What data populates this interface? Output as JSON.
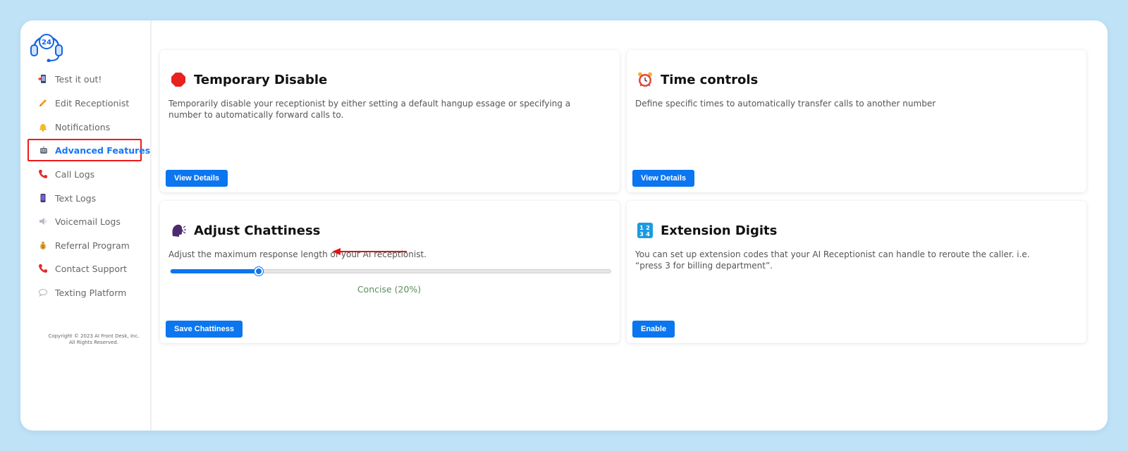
{
  "sidebar": {
    "items": [
      {
        "label": "Test it out!",
        "icon": "phone-icon",
        "active": false
      },
      {
        "label": "Edit Receptionist",
        "icon": "pencil-icon",
        "active": false
      },
      {
        "label": "Notifications",
        "icon": "bell-icon",
        "active": false
      },
      {
        "label": "Advanced Features",
        "icon": "robot-icon",
        "active": true
      },
      {
        "label": "Call Logs",
        "icon": "phone-receiver-icon",
        "active": false
      },
      {
        "label": "Text Logs",
        "icon": "mobile-phone-icon",
        "active": false
      },
      {
        "label": "Voicemail Logs",
        "icon": "speaker-icon",
        "active": false
      },
      {
        "label": "Referral Program",
        "icon": "money-bag-icon",
        "active": false
      },
      {
        "label": "Contact Support",
        "icon": "phone-receiver-icon",
        "active": false
      },
      {
        "label": "Texting Platform",
        "icon": "speech-bubble-icon",
        "active": false
      }
    ],
    "copyright_line1": "Copyright © 2023 AI Front Desk, Inc.",
    "copyright_line2": "All Rights Reserved."
  },
  "cards": {
    "temporary_disable": {
      "title": "Temporary Disable",
      "icon": "stop-sign-icon",
      "description": "Temporarily disable your receptionist by either setting a default hangup essage or specifying a number to automatically forward calls to.",
      "button": "View Details"
    },
    "time_controls": {
      "title": "Time controls",
      "icon": "alarm-clock-icon",
      "description": "Define specific times to automatically transfer calls to another number",
      "button": "View Details"
    },
    "adjust_chattiness": {
      "title": "Adjust Chattiness",
      "icon": "speaking-head-icon",
      "description": "Adjust the maximum response length of your AI receptionist.",
      "slider_fraction": 0.2,
      "slider_value_label": "Concise (20%)",
      "button": "Save Chattiness"
    },
    "extension_digits": {
      "title": "Extension Digits",
      "icon": "numbers-1234-icon",
      "description": "You can set up extension codes that your AI Receptionist can handle to reroute the caller. i.e. “press 3 for billing department”.",
      "button": "Enable"
    }
  },
  "colors": {
    "accent": "#0b76ef",
    "active_outline": "#ee1a1a",
    "background": "#bfe2f7",
    "slider_label": "#5a8f5a"
  }
}
